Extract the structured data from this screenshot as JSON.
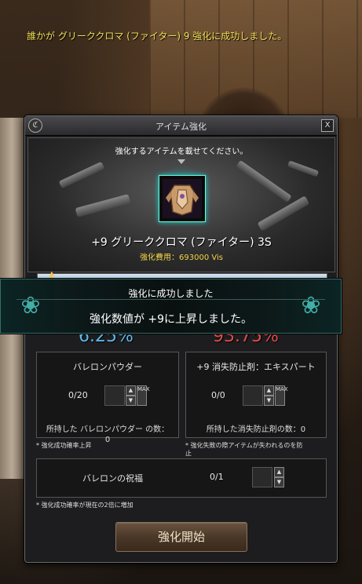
{
  "system_message": "誰かが グリーククロマ (ファイター) 9 強化に成功しました。",
  "window": {
    "title": "アイテム強化",
    "close_label": "X",
    "instruction": "強化するアイテムを載せてください。",
    "item_name": "+9 グリーククロマ (ファイター) 3S",
    "cost_label": "強化費用：",
    "cost_value": "693000 Vis",
    "success_rate": "6.25%",
    "fail_rate": "93.75%"
  },
  "popup": {
    "title": "強化に成功しました",
    "message": "強化数値が +9に上昇しました。"
  },
  "powder": {
    "title": "バレロンパウダー",
    "count": "0/20",
    "owned_label": "所持した バレロンパウダー の数：",
    "owned_value": "0",
    "note": "* 強化成功確率上昇"
  },
  "protect": {
    "title": "+9 消失防止剤：エキスパート",
    "count": "0/0",
    "owned_label": "所持した消失防止剤の数：0",
    "note_line1": "* 強化失敗の際アイテムが失われるのを防",
    "note_line2": "止"
  },
  "blessing": {
    "title": "バレロンの祝福",
    "count": "0/1",
    "note": "* 強化成功確率が現在の2倍に増加"
  },
  "controls": {
    "up": "▲",
    "down": "▼",
    "max": "MAX"
  },
  "start_button": "強化開始",
  "colors": {
    "system_message": "#f1df57",
    "success_rate": "#5fb6e8",
    "fail_rate": "#e24b4b",
    "cost": "#f3d347"
  }
}
